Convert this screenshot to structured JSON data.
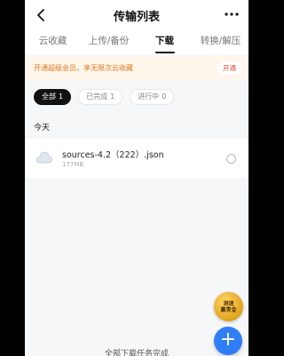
{
  "header": {
    "title": "传输列表"
  },
  "tabs": [
    {
      "label": "云收藏",
      "active": false
    },
    {
      "label": "上传/备份",
      "active": false
    },
    {
      "label": "下载",
      "active": true
    },
    {
      "label": "转换/解压",
      "active": false
    }
  ],
  "promo": {
    "text": "开通超级会员，享无限次云收藏",
    "button": "开通"
  },
  "filters": [
    {
      "label": "全部",
      "count": "1",
      "active": true
    },
    {
      "label": "已完成",
      "count": "1",
      "active": false
    },
    {
      "label": "进行中",
      "count": "0",
      "active": false
    }
  ],
  "section": {
    "label": "今天"
  },
  "files": [
    {
      "name": "sources-4.2（222）.json",
      "size": "177MB",
      "icon": "cloud-file-icon"
    }
  ],
  "badge": {
    "line1": "测速",
    "line2": "赢青金"
  },
  "fab": {
    "label": "+"
  },
  "footer": {
    "text": "全部下载任务完成"
  },
  "colors": {
    "accent": "#2f7df7",
    "promo_text": "#e07a1f",
    "promo_button": "#e23b2e",
    "badge_gold": "#e0a21a"
  }
}
